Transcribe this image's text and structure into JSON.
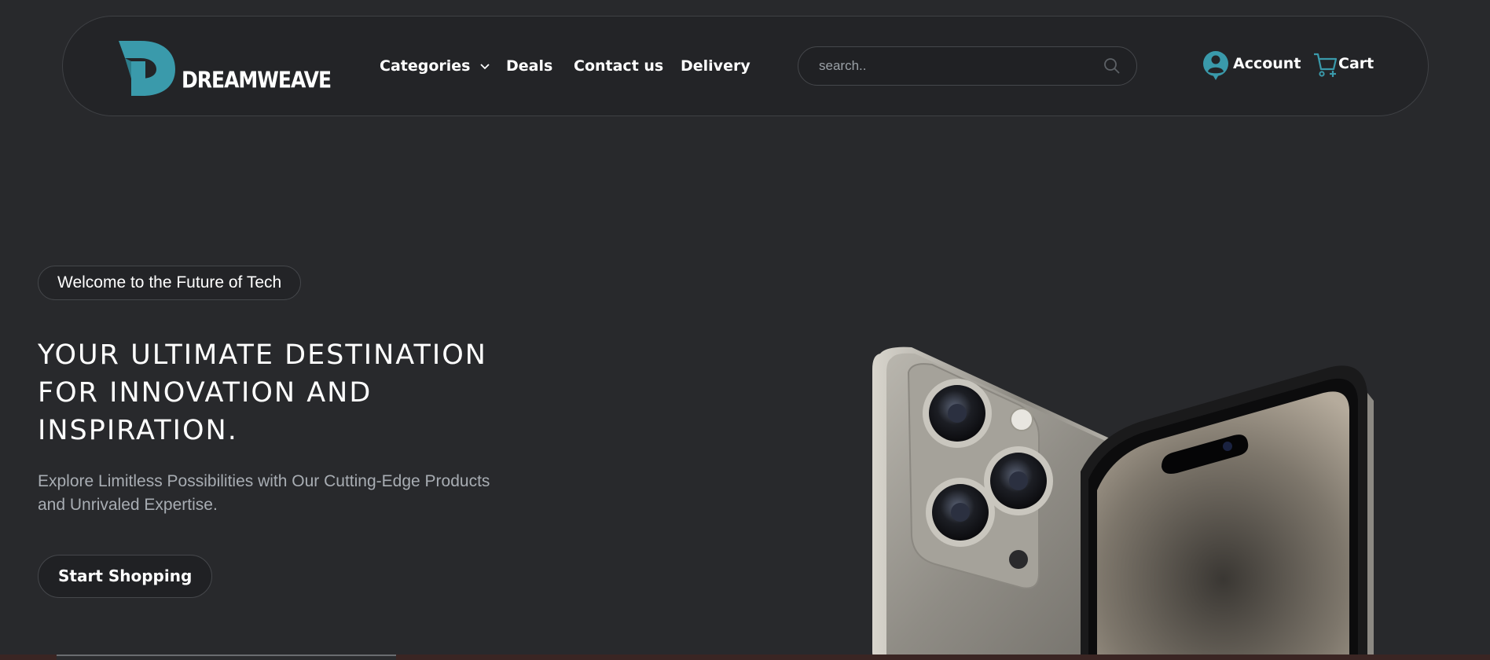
{
  "brand": {
    "name": "DREAMWEAVE",
    "accent_color": "#3a9aab",
    "logo_icon": "d-logo-icon"
  },
  "nav": {
    "items": [
      {
        "label": "Categories",
        "has_dropdown": true
      },
      {
        "label": "Deals"
      },
      {
        "label": "Contact us"
      },
      {
        "label": "Delivery"
      }
    ]
  },
  "search": {
    "placeholder": "search..",
    "value": "",
    "icon": "search-icon"
  },
  "account": {
    "label": "Account",
    "icon": "user-icon"
  },
  "cart": {
    "label": "Cart",
    "icon": "cart-icon"
  },
  "hero": {
    "pill": "Welcome to the Future of Tech",
    "headline": "YOUR ULTIMATE DESTINATION FOR INNOVATION AND INSPIRATION.",
    "subtext": "Explore Limitless Possibilities with Our Cutting-Edge Products and Unrivaled Expertise.",
    "cta": "Start Shopping",
    "image": "smartphone-product-image"
  },
  "colors": {
    "background": "#28292c",
    "nav_background": "#232427",
    "muted_text": "#a8adb3"
  }
}
